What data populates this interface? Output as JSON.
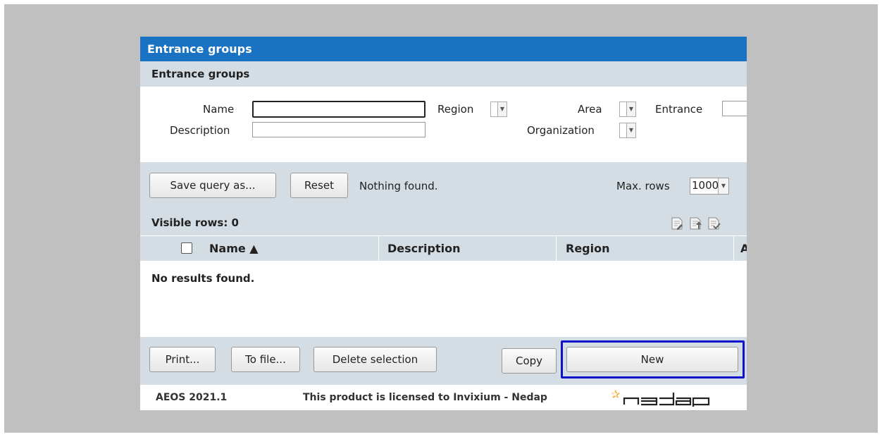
{
  "window": {
    "title": "Entrance groups",
    "section_title": "Entrance groups"
  },
  "filters": {
    "name_label": "Name",
    "name_value": "",
    "description_label": "Description",
    "description_value": "",
    "region_label": "Region",
    "area_label": "Area",
    "entrance_label": "Entrance",
    "organization_label": "Organization"
  },
  "toolbar": {
    "save_query_label": "Save query as...",
    "reset_label": "Reset",
    "status_text": "Nothing found.",
    "max_rows_label": "Max. rows",
    "max_rows_value": "1000"
  },
  "results": {
    "visible_rows_label": "Visible rows: 0",
    "columns": [
      "Name ▲",
      "Description",
      "Region",
      "A"
    ],
    "empty_text": "No results found."
  },
  "actions": {
    "print_label": "Print...",
    "to_file_label": "To file...",
    "delete_label": "Delete selection",
    "copy_label": "Copy",
    "new_label": "New"
  },
  "footer": {
    "version": "AEOS 2021.1",
    "license": "This product is licensed to Invixium - Nedap",
    "brand": "nedap"
  },
  "colors": {
    "titlebar": "#1a73c2",
    "panel_gray": "#d5dde4",
    "focus_outline": "#1111cc",
    "logo_star": "#f5a623"
  },
  "icons": [
    "edit-columns-icon",
    "export-icon",
    "check-list-icon"
  ]
}
